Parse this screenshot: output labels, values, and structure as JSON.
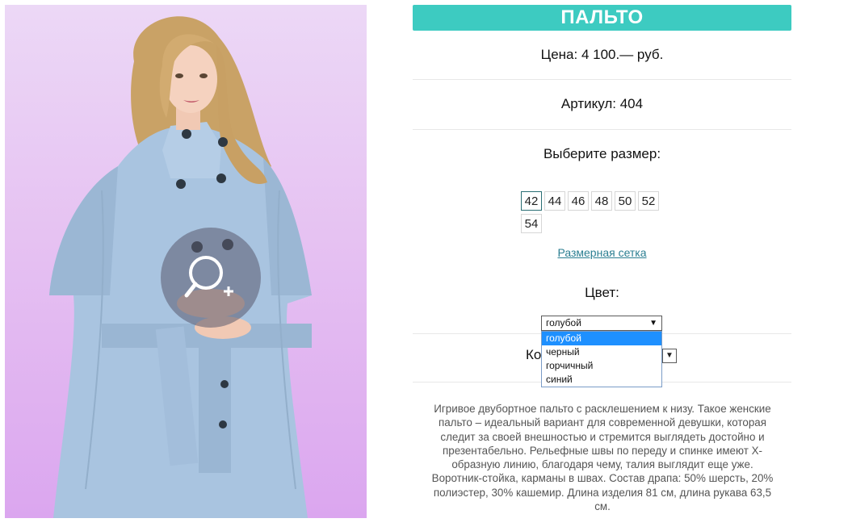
{
  "product": {
    "title": "ПАЛЬТО",
    "price": "Цена: 4 100.— руб.",
    "article": "Артикул: 404",
    "size_prompt": "Выберите размер:",
    "sizes": [
      "42",
      "44",
      "46",
      "48",
      "50",
      "52",
      "54"
    ],
    "selected_size": "42",
    "size_chart_link": "Размерная сетка",
    "color_label": "Цвет:",
    "color_selected": "голубой",
    "color_options": [
      "голубой",
      "черный",
      "горчичный",
      "синий"
    ],
    "quantity_label_visible": "Ко",
    "description": "Игривое двубортное пальто с расклешением к низу. Такое женские пальто – идеальный вариант для современной девушки, которая следит за своей внешностью и стремится выглядеть достойно и презентабельно. Рельефные швы по переду и спинке имеют X-образную линию, благодаря чему, талия выглядит еще уже. Воротник-стойка, карманы в швах. Состав драпа: 50% шерсть, 20% полиэстер, 30% кашемир. Длина изделия 81 см, длина рукава 63,5 см."
  },
  "icons": {
    "zoom": "zoom-in-icon",
    "dropdown_arrow": "▼"
  },
  "colors": {
    "accent": "#3dcbc1",
    "link": "#2c7f92",
    "coat": "#a9c4e0",
    "background_photo": "#e6c2f2"
  }
}
